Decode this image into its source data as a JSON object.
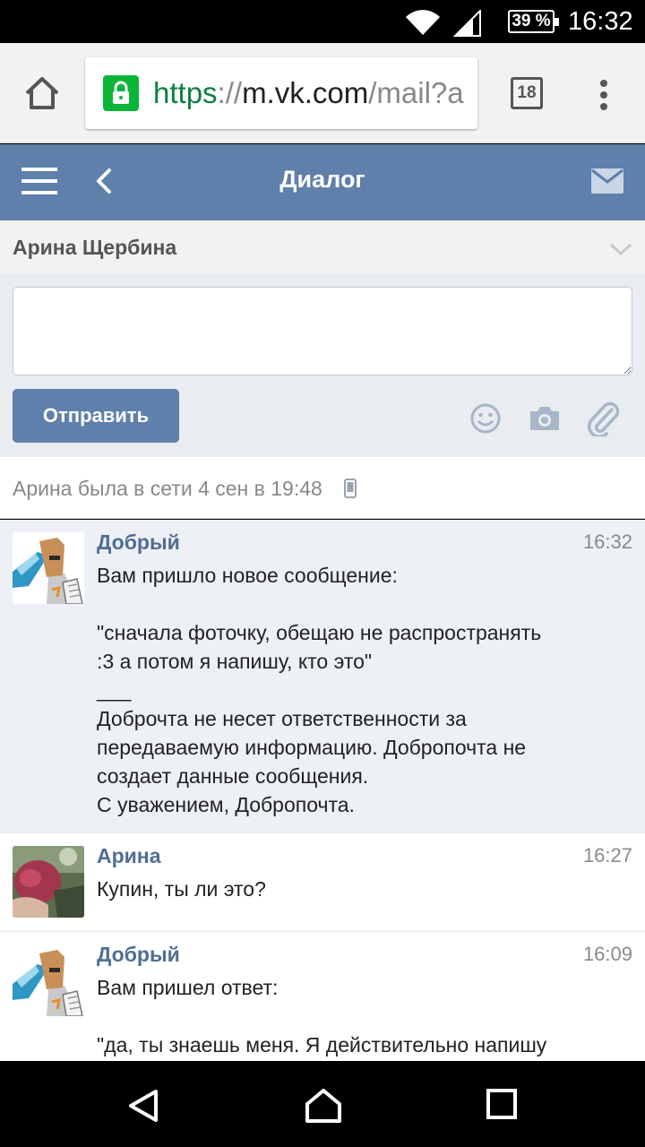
{
  "status_bar": {
    "battery": "39 %",
    "time": "16:32",
    "icons": [
      "wifi-icon",
      "signal-icon",
      "battery-icon"
    ]
  },
  "browser": {
    "url_scheme": "https",
    "url_separator": "://",
    "url_host": "m.vk.com",
    "url_path": "/mail?a",
    "tab_count": "18",
    "icons": [
      "home-icon",
      "lock-icon",
      "overflow-menu-icon"
    ]
  },
  "header": {
    "title": "Диалог",
    "icons": [
      "menu-icon",
      "back-icon",
      "mail-icon"
    ]
  },
  "peer": {
    "name": "Арина Щербина"
  },
  "compose": {
    "text_value": "",
    "send_label": "Отправить",
    "icons": [
      "smile-icon",
      "camera-icon",
      "attach-icon"
    ]
  },
  "last_seen": "Арина была в сети 4 сен в 19:48",
  "messages": [
    {
      "author": "Добрый",
      "time": "16:32",
      "text": "Вам пришло новое сообщение:\n\n\"сначала фоточку, обещаю не распространять\n:3 а потом я напишу, кто это\"\n___\nДоброчта не несет ответственности за\nпередаваемую информацию. Добропочта не\nсоздает данные сообщения.\nС уважением, Добропочта.",
      "unread": true
    },
    {
      "author": "Арина",
      "time": "16:27",
      "text": "Купин, ты ли это?",
      "unread": false
    },
    {
      "author": "Добрый",
      "time": "16:09",
      "text": "Вам пришел ответ:\n\n\"да, ты знаешь меня. Я действительно напишу",
      "unread": false
    }
  ],
  "colors": {
    "vk_blue": "#5e80aa",
    "link_blue": "#4f6e96",
    "unread_bg": "#edf0f5",
    "secure_green": "#0ab538"
  }
}
